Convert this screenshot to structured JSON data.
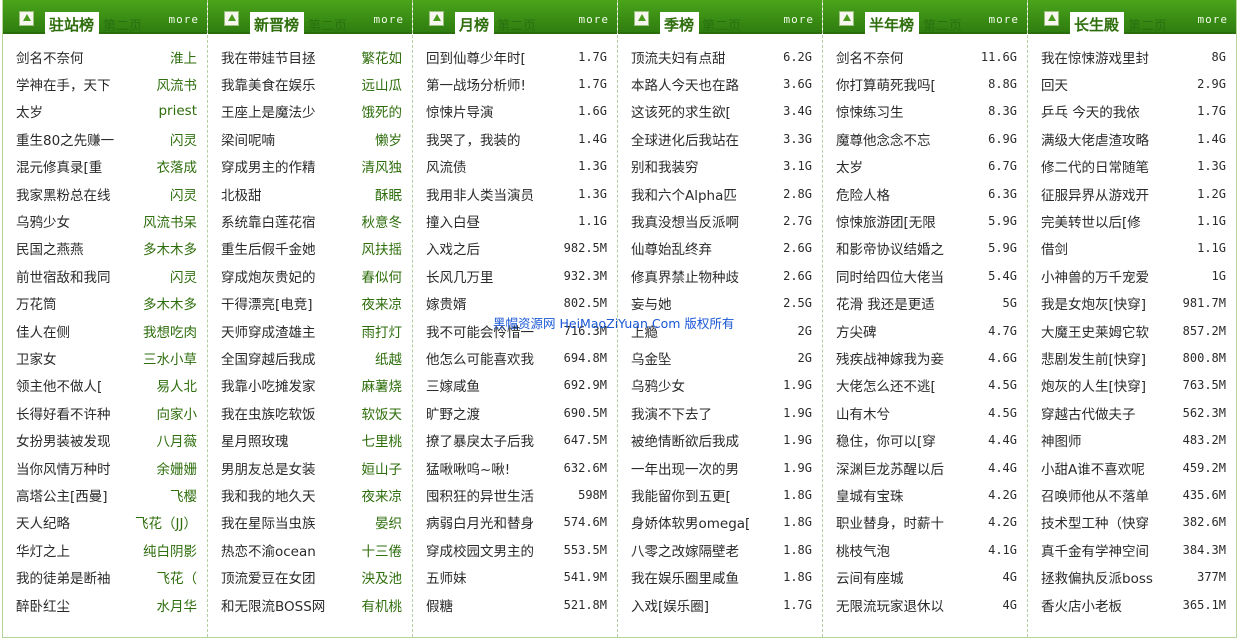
{
  "watermark": "黑帽资源网 HeiMaoZiYuan.Com 版权所有",
  "panels": [
    {
      "title": "驻站榜",
      "sub": "第二页",
      "more": "more",
      "kind": "author",
      "items": [
        {
          "t": "剑名不奈何",
          "v": "淮上"
        },
        {
          "t": "学神在手，天下",
          "v": "风流书"
        },
        {
          "t": "太岁",
          "v": "priest"
        },
        {
          "t": "重生80之先赚一",
          "v": "闪灵"
        },
        {
          "t": "混元修真录[重",
          "v": "衣落成"
        },
        {
          "t": "我家黑粉总在线",
          "v": "闪灵"
        },
        {
          "t": "乌鸦少女",
          "v": "风流书呆"
        },
        {
          "t": "民国之燕燕",
          "v": "多木木多"
        },
        {
          "t": "前世宿敌和我同",
          "v": "闪灵"
        },
        {
          "t": "万花筒",
          "v": "多木木多"
        },
        {
          "t": "佳人在侧",
          "v": "我想吃肉"
        },
        {
          "t": "卫家女",
          "v": "三水小草"
        },
        {
          "t": "领主他不做人[",
          "v": "易人北"
        },
        {
          "t": "长得好看不许种",
          "v": "向家小"
        },
        {
          "t": "女扮男装被发现",
          "v": "八月薇"
        },
        {
          "t": "当你风情万种时",
          "v": "余姗姗"
        },
        {
          "t": "高塔公主[西曼]",
          "v": "飞樱"
        },
        {
          "t": "天人纪略",
          "v": "飞花（JJ）"
        },
        {
          "t": "华灯之上",
          "v": "纯白阴影"
        },
        {
          "t": "我的徒弟是断袖",
          "v": "飞花（"
        },
        {
          "t": "醉卧红尘",
          "v": "水月华"
        }
      ]
    },
    {
      "title": "新晋榜",
      "sub": "第二页",
      "more": "more",
      "kind": "author",
      "items": [
        {
          "t": "我在带娃节目拯",
          "v": "繁花如"
        },
        {
          "t": "我靠美食在娱乐",
          "v": "远山瓜"
        },
        {
          "t": "王座上是魔法少",
          "v": "饿死的"
        },
        {
          "t": "梁间呢喃",
          "v": "懒岁"
        },
        {
          "t": "穿成男主的作精",
          "v": "清风独"
        },
        {
          "t": "北极甜",
          "v": "酥眠"
        },
        {
          "t": "系统靠白莲花宿",
          "v": "秋意冬"
        },
        {
          "t": "重生后假千金她",
          "v": "风扶摇"
        },
        {
          "t": "穿成炮灰贵妃的",
          "v": "春似何"
        },
        {
          "t": "干得漂亮[电竞]",
          "v": "夜来凉"
        },
        {
          "t": "天师穿成渣雄主",
          "v": "雨打灯"
        },
        {
          "t": "全国穿越后我成",
          "v": "纸越"
        },
        {
          "t": "我靠小吃摊发家",
          "v": "麻薯烧"
        },
        {
          "t": "我在虫族吃软饭",
          "v": "软饭天"
        },
        {
          "t": "星月照玫瑰",
          "v": "七里桃"
        },
        {
          "t": "男朋友总是女装",
          "v": "姮山子"
        },
        {
          "t": "我和我的地久天",
          "v": "夜来凉"
        },
        {
          "t": "我在星际当虫族",
          "v": "晏织"
        },
        {
          "t": "热恋不渝ocean",
          "v": "十三倦"
        },
        {
          "t": "顶流爱豆在女团",
          "v": "泱及池"
        },
        {
          "t": "和无限流BOSS网",
          "v": "有机桃"
        }
      ]
    },
    {
      "title": "月榜",
      "sub": "第二页",
      "more": "more",
      "kind": "size",
      "items": [
        {
          "t": "回到仙尊少年时[",
          "v": "1.7G"
        },
        {
          "t": "第一战场分析师!",
          "v": "1.7G"
        },
        {
          "t": "惊悚片导演",
          "v": "1.6G"
        },
        {
          "t": "我哭了，我装的",
          "v": "1.4G"
        },
        {
          "t": "风流债",
          "v": "1.3G"
        },
        {
          "t": "我用非人类当演员",
          "v": "1.3G"
        },
        {
          "t": "撞入白昼",
          "v": "1.1G"
        },
        {
          "t": "入戏之后",
          "v": "982.5M"
        },
        {
          "t": "长风几万里",
          "v": "932.3M"
        },
        {
          "t": "嫁贵婿",
          "v": "802.5M"
        },
        {
          "t": "我不可能会怜惜一",
          "v": "716.3M"
        },
        {
          "t": "他怎么可能喜欢我",
          "v": "694.8M"
        },
        {
          "t": "三嫁咸鱼",
          "v": "692.9M"
        },
        {
          "t": "旷野之渡",
          "v": "690.5M"
        },
        {
          "t": "撩了暴戾太子后我",
          "v": "647.5M"
        },
        {
          "t": "猛啾啾呜~啾!",
          "v": "632.6M"
        },
        {
          "t": "囤积狂的异世生活",
          "v": "598M"
        },
        {
          "t": "病弱白月光和替身",
          "v": "574.6M"
        },
        {
          "t": "穿成校园文男主的",
          "v": "553.5M"
        },
        {
          "t": "五师妹",
          "v": "541.9M"
        },
        {
          "t": "假糖",
          "v": "521.8M"
        }
      ]
    },
    {
      "title": "季榜",
      "sub": "第二页",
      "more": "more",
      "kind": "size",
      "items": [
        {
          "t": "顶流夫妇有点甜",
          "v": "6.2G"
        },
        {
          "t": "本路人今天也在路",
          "v": "3.6G"
        },
        {
          "t": "这该死的求生欲[",
          "v": "3.4G"
        },
        {
          "t": "全球进化后我站在",
          "v": "3.3G"
        },
        {
          "t": "别和我装穷",
          "v": "3.1G"
        },
        {
          "t": "我和六个Alpha匹",
          "v": "2.8G"
        },
        {
          "t": "我真没想当反派啊",
          "v": "2.7G"
        },
        {
          "t": "仙尊始乱终弃",
          "v": "2.6G"
        },
        {
          "t": "修真界禁止物种歧",
          "v": "2.6G"
        },
        {
          "t": "妄与她",
          "v": "2.5G"
        },
        {
          "t": "上瘾",
          "v": "2G"
        },
        {
          "t": "乌金坠",
          "v": "2G"
        },
        {
          "t": "乌鸦少女",
          "v": "1.9G"
        },
        {
          "t": "我演不下去了",
          "v": "1.9G"
        },
        {
          "t": "被绝情断欲后我成",
          "v": "1.9G"
        },
        {
          "t": "一年出现一次的男",
          "v": "1.9G"
        },
        {
          "t": "我能留你到五更[",
          "v": "1.8G"
        },
        {
          "t": "身娇体软男omega[",
          "v": "1.8G"
        },
        {
          "t": "八零之改嫁隔壁老",
          "v": "1.8G"
        },
        {
          "t": "我在娱乐圈里咸鱼",
          "v": "1.8G"
        },
        {
          "t": "入戏[娱乐圈]",
          "v": "1.7G"
        }
      ]
    },
    {
      "title": "半年榜",
      "sub": "第二页",
      "more": "more",
      "kind": "size",
      "items": [
        {
          "t": "剑名不奈何",
          "v": "11.6G"
        },
        {
          "t": "你打算萌死我吗[",
          "v": "8.8G"
        },
        {
          "t": "惊悚练习生",
          "v": "8.3G"
        },
        {
          "t": "魔尊他念念不忘",
          "v": "6.9G"
        },
        {
          "t": "太岁",
          "v": "6.7G"
        },
        {
          "t": "危险人格",
          "v": "6.3G"
        },
        {
          "t": "惊悚旅游团[无限",
          "v": "5.9G"
        },
        {
          "t": "和影帝协议结婚之",
          "v": "5.9G"
        },
        {
          "t": "同时给四位大佬当",
          "v": "5.4G"
        },
        {
          "t": "花滑 我还是更适",
          "v": "5G"
        },
        {
          "t": "方尖碑",
          "v": "4.7G"
        },
        {
          "t": "残疾战神嫁我为妾",
          "v": "4.6G"
        },
        {
          "t": "大佬怎么还不逃[",
          "v": "4.5G"
        },
        {
          "t": "山有木兮",
          "v": "4.5G"
        },
        {
          "t": "稳住，你可以[穿",
          "v": "4.4G"
        },
        {
          "t": "深渊巨龙苏醒以后",
          "v": "4.4G"
        },
        {
          "t": "皇城有宝珠",
          "v": "4.2G"
        },
        {
          "t": "职业替身，时薪十",
          "v": "4.2G"
        },
        {
          "t": "桃枝气泡",
          "v": "4.1G"
        },
        {
          "t": "云间有座城",
          "v": "4G"
        },
        {
          "t": "无限流玩家退休以",
          "v": "4G"
        }
      ]
    },
    {
      "title": "长生殿",
      "sub": "第二页",
      "more": "more",
      "kind": "size",
      "items": [
        {
          "t": "我在惊悚游戏里封",
          "v": "8G"
        },
        {
          "t": "回天",
          "v": "2.9G"
        },
        {
          "t": "乒乓 今天的我依",
          "v": "1.7G"
        },
        {
          "t": "满级大佬虐渣攻略",
          "v": "1.4G"
        },
        {
          "t": "修二代的日常随笔",
          "v": "1.3G"
        },
        {
          "t": "征服异界从游戏开",
          "v": "1.2G"
        },
        {
          "t": "完美转世以后[修",
          "v": "1.1G"
        },
        {
          "t": "借剑",
          "v": "1.1G"
        },
        {
          "t": "小神兽的万千宠爱",
          "v": "1G"
        },
        {
          "t": "我是女炮灰[快穿]",
          "v": "981.7M"
        },
        {
          "t": "大魔王史莱姆它软",
          "v": "857.2M"
        },
        {
          "t": "悲剧发生前[快穿]",
          "v": "800.8M"
        },
        {
          "t": "炮灰的人生[快穿]",
          "v": "763.5M"
        },
        {
          "t": "穿越古代做夫子",
          "v": "562.3M"
        },
        {
          "t": "神图师",
          "v": "483.2M"
        },
        {
          "t": "小甜A谁不喜欢呢",
          "v": "459.2M"
        },
        {
          "t": "召唤师他从不落单",
          "v": "435.6M"
        },
        {
          "t": "技术型工种（快穿",
          "v": "382.6M"
        },
        {
          "t": "真千金有学神空间",
          "v": "384.3M"
        },
        {
          "t": "拯救偏执反派boss",
          "v": "377M"
        },
        {
          "t": "香火店小老板",
          "v": "365.1M"
        }
      ]
    }
  ]
}
